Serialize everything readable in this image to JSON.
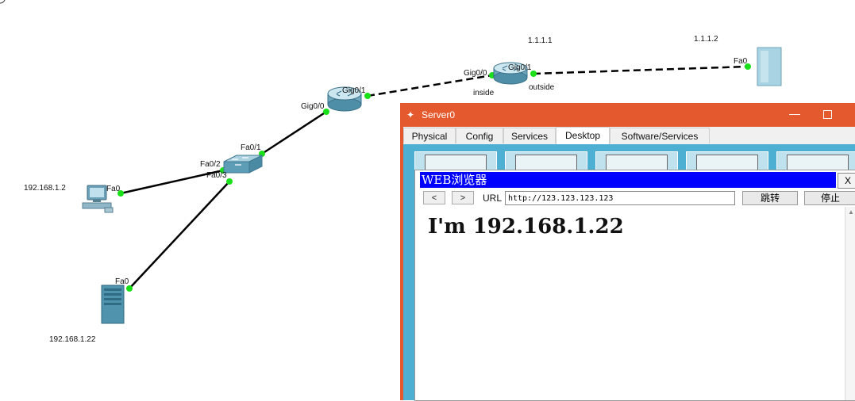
{
  "topology": {
    "labels": {
      "pc_ip": "192.168.1.2",
      "server_ip": "192.168.1.22",
      "r2_ip": "1.1.1.1",
      "remote_server_ip": "1.1.1.2",
      "pc_fa0": "Fa0",
      "server_fa0": "Fa0",
      "sw_fa0_1": "Fa0/1",
      "sw_fa0_2": "Fa0/2",
      "sw_fa0_3": "Fa0/3",
      "r1_gig0_0": "Gig0/0",
      "r1_gig0_1": "Gig0/1",
      "r2_gig0_0": "Gig0/0",
      "r2_gig0_1": "Gig0/1",
      "inside": "inside",
      "outside": "outside",
      "remote_fa0": "Fa0"
    },
    "colors": {
      "link": "#000000",
      "port_up": "#19e019"
    }
  },
  "window": {
    "title": "Server0",
    "app_icon": "packet-tracer-icon",
    "minimize": "—",
    "tabs": [
      {
        "label": "Physical"
      },
      {
        "label": "Config"
      },
      {
        "label": "Services"
      },
      {
        "label": "Desktop"
      },
      {
        "label": "Software/Services"
      }
    ],
    "active_tab": "Desktop",
    "accent": "#e45a2e",
    "desktop_bg": "#4db0d2"
  },
  "browser": {
    "title": "WEB浏览器",
    "close_label": "X",
    "back_label": "<",
    "forward_label": ">",
    "url_label": "URL",
    "url_value": "http://123.123.123.123",
    "go_label": "跳转",
    "stop_label": "停止",
    "page_text": "I'm 192.168.1.22",
    "title_bg": "#0000ff"
  }
}
